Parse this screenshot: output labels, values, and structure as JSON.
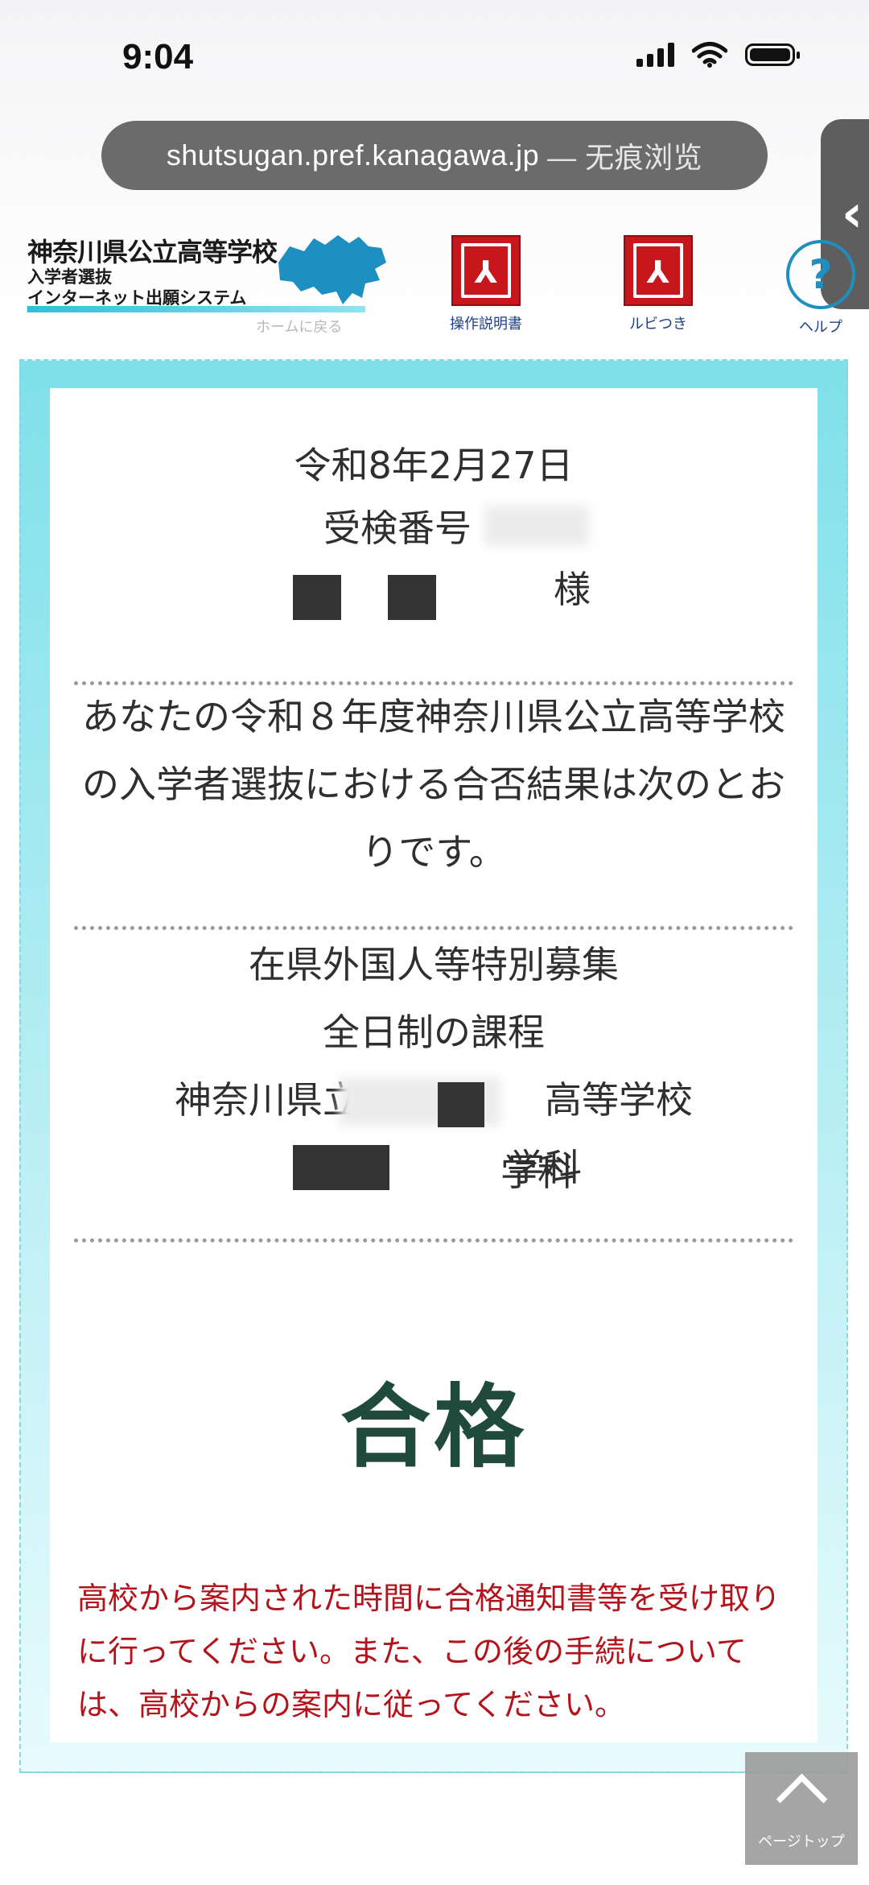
{
  "status": {
    "time": "9:04"
  },
  "browser": {
    "domain": "shutsugan.pref.kanagawa.jp",
    "mode": "— 无痕浏览",
    "side_tab_glyph": "‹"
  },
  "header": {
    "logo_title": "神奈川県公立高等学校",
    "logo_sub1": "入学者選抜",
    "logo_sub2": "インターネット出願システム",
    "home_link": "ホームに戻る",
    "manual_label": "操作説明書",
    "ruby_label": "ルビつき",
    "help_label": "ヘルプ",
    "help_glyph": "?",
    "pdf_glyph": "⅄"
  },
  "result_page": {
    "date": "令和8年2月27日",
    "exam_number_label": "受検番号",
    "honorific": "様",
    "intro": "あなたの令和８年度神奈川県公立高等学校の入学者選抜における合否結果は次のとおりです。",
    "course_lines": [
      "在県外国人等特別募集",
      "全日制の課程",
      "神奈川県立　　　　　高等学校",
      "　　　　　　学科"
    ],
    "result": "合格",
    "notice": "高校から案内された時間に合格通知書等を受け取りに行ってください。また、この後の手続については、高校からの案内に従ってください。"
  },
  "page_top": {
    "label": "ページトップ"
  },
  "colors": {
    "result": "#1f4a3c",
    "notice": "#b3141c",
    "card_border": "#7fe0ea",
    "pdf": "#c8161d"
  }
}
